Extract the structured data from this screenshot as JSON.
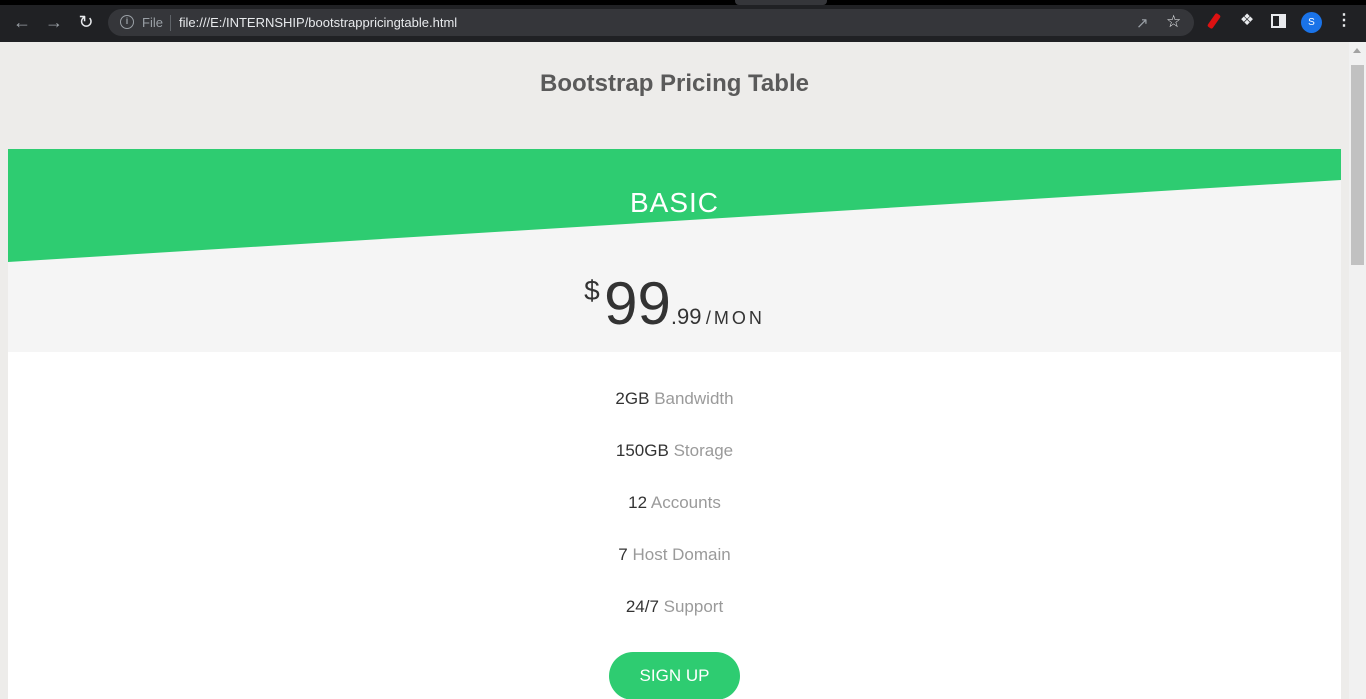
{
  "browser": {
    "file_label": "File",
    "url": "file:///E:/INTERNSHIP/bootstrappricingtable.html",
    "avatar_letter": "S",
    "accent_color": "#1a73e8"
  },
  "page": {
    "title": "Bootstrap Pricing Table"
  },
  "pricing": {
    "plan": "BASIC",
    "currency": "$",
    "amount": "99",
    "cents": ".99",
    "period": "/MON",
    "accent_color": "#2ecc71",
    "features": [
      {
        "value": "2GB",
        "label": "Bandwidth"
      },
      {
        "value": "150GB",
        "label": "Storage"
      },
      {
        "value": "12",
        "label": "Accounts"
      },
      {
        "value": "7",
        "label": "Host Domain"
      },
      {
        "value": "24/7",
        "label": "Support"
      }
    ],
    "cta": "SIGN UP"
  }
}
